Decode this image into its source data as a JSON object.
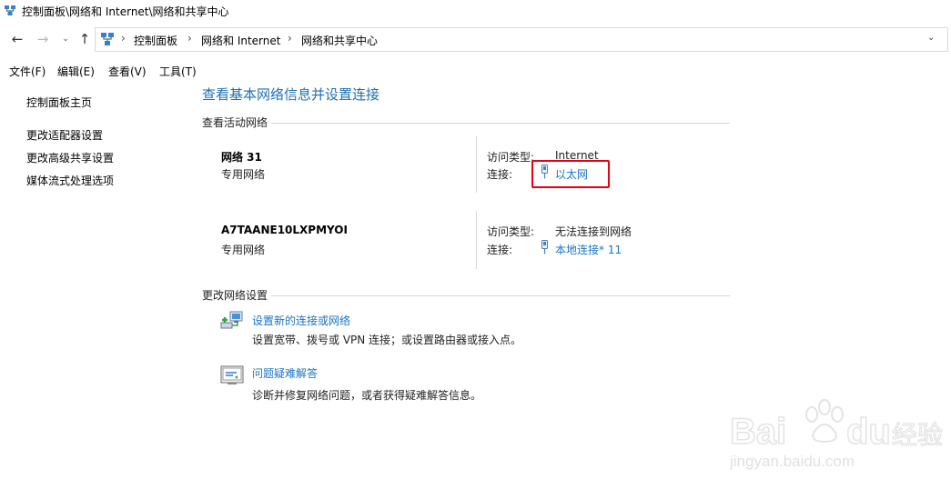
{
  "window": {
    "title": "控制面板\\网络和 Internet\\网络和共享中心"
  },
  "address": {
    "crumbs": [
      "控制面板",
      "网络和 Internet",
      "网络和共享中心"
    ],
    "separator": "›"
  },
  "menu": [
    "文件(F)",
    "编辑(E)",
    "查看(V)",
    "工具(T)"
  ],
  "sidebar": {
    "items": [
      {
        "label": "控制面板主页"
      },
      {
        "label": "更改适配器设置"
      },
      {
        "label": "更改高级共享设置"
      },
      {
        "label": "媒体流式处理选项"
      }
    ]
  },
  "main": {
    "heading": "查看基本网络信息并设置连接",
    "active_networks_title": "查看活动网络",
    "networks": [
      {
        "name": "网络 31",
        "category": "专用网络",
        "access_label": "访问类型:",
        "access_value": "Internet",
        "conn_label": "连接:",
        "conn_value": "以太网"
      },
      {
        "name": "A7TAANE10LXPMYOI",
        "category": "专用网络",
        "access_label": "访问类型:",
        "access_value": "无法连接到网络",
        "conn_label": "连接:",
        "conn_value": "本地连接* 11"
      }
    ],
    "change_settings_title": "更改网络设置",
    "tasks": [
      {
        "link": "设置新的连接或网络",
        "desc": "设置宽带、拨号或 VPN 连接；或设置路由器或接入点。",
        "icon": "network-setup-icon"
      },
      {
        "link": "问题疑难解答",
        "desc": "诊断并修复网络问题，或者获得疑难解答信息。",
        "icon": "troubleshoot-icon"
      }
    ]
  },
  "watermark": {
    "text": "Baidu经验",
    "url": "jingyan.baidu.com"
  },
  "colors": {
    "link": "#1a73c4",
    "heading": "#1e6fb3",
    "highlight": "#e60012"
  }
}
